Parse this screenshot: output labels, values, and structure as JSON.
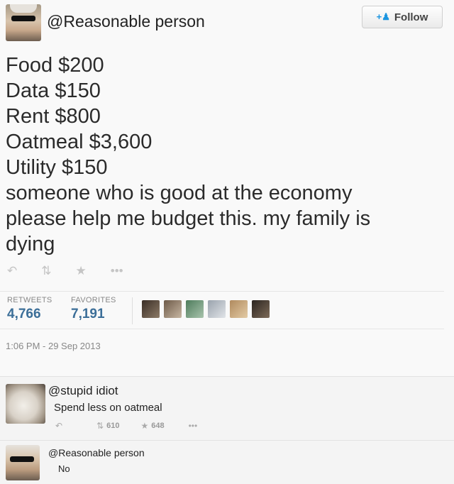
{
  "tweet": {
    "handle": "@Reasonable person",
    "follow_label": "Follow",
    "lines": [
      "Food $200",
      "Data $150",
      "Rent $800",
      "Oatmeal $3,600",
      "Utility $150",
      "someone who is good at the economy",
      "please help me budget this. my family is",
      "dying"
    ],
    "actions": {
      "reply_icon": "reply-icon",
      "retweet_icon": "retweet-icon",
      "favorite_icon": "star-icon",
      "more_icon": "more-icon"
    },
    "stats": {
      "retweets_label": "RETWEETS",
      "retweets_value": "4,766",
      "favorites_label": "FAVORITES",
      "favorites_value": "7,191"
    },
    "timestamp": "1:06 PM - 29 Sep 2013"
  },
  "replies": [
    {
      "handle": "@stupid idiot",
      "text": "Spend less on oatmeal",
      "retweet_count": "610",
      "favorite_count": "648"
    },
    {
      "handle": "@Reasonable person",
      "text": "No"
    }
  ],
  "colors": {
    "stat_value": "#3b6e98",
    "follow_icon": "#1b95e0"
  }
}
